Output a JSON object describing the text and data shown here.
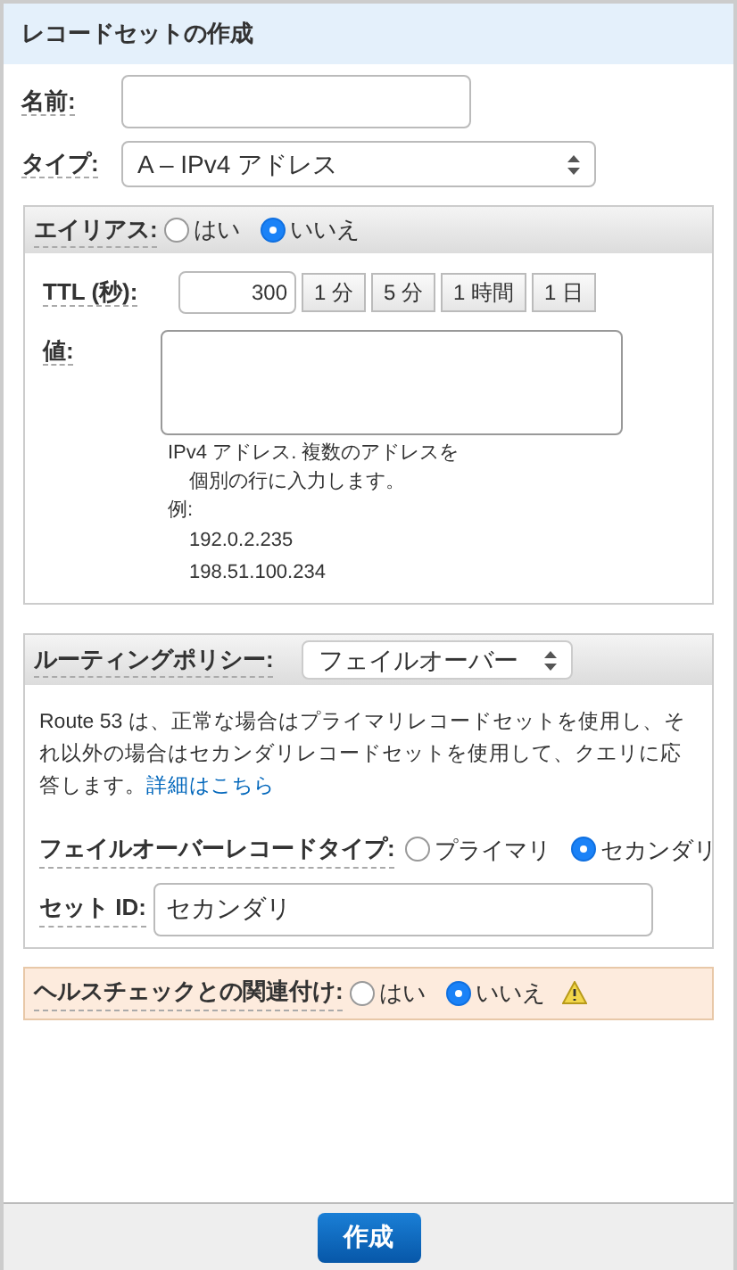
{
  "title": "レコードセットの作成",
  "name_field": {
    "label": "名前:"
  },
  "type_field": {
    "label": "タイプ:",
    "value": "A – IPv4 アドレス"
  },
  "alias": {
    "label": "エイリアス:",
    "options": [
      {
        "label": "はい",
        "selected": false
      },
      {
        "label": "いいえ",
        "selected": true
      }
    ]
  },
  "ttl": {
    "label": "TTL (秒):",
    "value": "300",
    "presets": [
      "1 分",
      "5 分",
      "1 時間",
      "1 日"
    ]
  },
  "value_field": {
    "label": "値:",
    "help": [
      "IPv4 アドレス. 複数のアドレスを",
      "個別の行に入力します。"
    ],
    "example_label": "例:",
    "examples": [
      "192.0.2.235",
      "198.51.100.234"
    ]
  },
  "routing": {
    "label": "ルーティングポリシー:",
    "value": "フェイルオーバー",
    "description": "Route 53 は、正常な場合はプライマリレコードセットを使用し、それ以外の場合はセカンダリレコードセットを使用して、クエリに応答します。",
    "link": "詳細はこちら",
    "failover_type": {
      "label": "フェイルオーバーレコードタイプ:",
      "options": [
        {
          "label": "プライマリ",
          "selected": false
        },
        {
          "label": "セカンダリ",
          "selected": true
        }
      ]
    },
    "set_id": {
      "label": "セット ID:",
      "value": "セカンダリ"
    }
  },
  "health_check": {
    "label": "ヘルスチェックとの関連付け:",
    "options": [
      {
        "label": "はい",
        "selected": false
      },
      {
        "label": "いいえ",
        "selected": true
      }
    ]
  },
  "submit": "作成"
}
